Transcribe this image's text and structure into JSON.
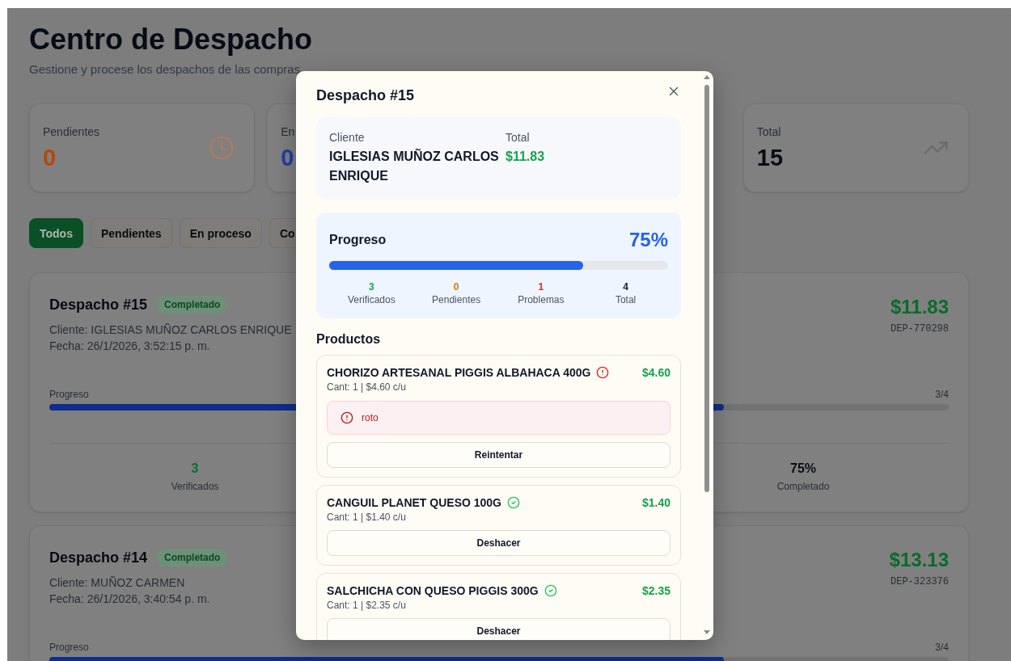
{
  "page": {
    "title": "Centro de Despacho",
    "subtitle": "Gestione y procese los despachos de las compras"
  },
  "stats": [
    {
      "label": "Pendientes",
      "value": "0",
      "color": "#b8450d",
      "kind": "clock"
    },
    {
      "label": "En",
      "value": "0",
      "color": "#1e3fa6",
      "kind": "none"
    },
    {
      "label": "Total",
      "value": "15",
      "color": "#0b0d12",
      "kind": "trend"
    }
  ],
  "filters": [
    {
      "label": "Todos",
      "selected": true
    },
    {
      "label": "Pendientes",
      "selected": false
    },
    {
      "label": "En proceso",
      "selected": false
    },
    {
      "label": "Co",
      "selected": false
    }
  ],
  "dispatches": [
    {
      "title": "Despacho #15",
      "status": "Completado",
      "client": "Cliente: IGLESIAS MUÑOZ CARLOS ENRIQUE",
      "date": "Fecha: 26/1/2026, 3:52:15 p. m.",
      "amount": "$11.83",
      "code": "DEP-770298",
      "progress_label": "Progreso",
      "progress_count": "3/4",
      "level": 0.75,
      "stats": [
        {
          "value": "3",
          "label": "Verificados",
          "color": "#0f6b30"
        },
        {
          "value": "75%",
          "label": "Completado",
          "color": "#0b0d12"
        }
      ]
    },
    {
      "title": "Despacho #14",
      "status": "Completado",
      "client": "Cliente: MUÑOZ CARMEN",
      "date": "Fecha: 26/1/2026, 3:40:54 p. m.",
      "amount": "$13.13",
      "code": "DEP-323376",
      "progress_label": "Progreso",
      "progress_count": "3/4",
      "level": 0.75
    }
  ],
  "modal": {
    "title": "Despacho #15",
    "client_label": "Cliente",
    "client_name": "IGLESIAS MUÑOZ CARLOS ENRIQUE",
    "total_label": "Total",
    "total_value": "$11.83",
    "progress": {
      "label": "Progreso",
      "percent": "75%",
      "level": 0.75,
      "stats": [
        {
          "value": "3",
          "label": "Verificados",
          "color": "#16a34a"
        },
        {
          "value": "0",
          "label": "Pendientes",
          "color": "#d97706"
        },
        {
          "value": "1",
          "label": "Problemas",
          "color": "#dc2626"
        },
        {
          "value": "4",
          "label": "Total",
          "color": "#111827"
        }
      ]
    },
    "products_heading": "Productos",
    "products": [
      {
        "name": "CHORIZO ARTESANAL PIGGIS ALBAHACA 400G",
        "kind": "problem",
        "detail": "Cant: 1 | $4.60 c/u",
        "price": "$4.60",
        "issue": "roto",
        "action": "Reintentar"
      },
      {
        "name": "CANGUIL PLANET QUESO 100G",
        "kind": "verified",
        "detail": "Cant: 1 | $1.40 c/u",
        "price": "$1.40",
        "action": "Deshacer"
      },
      {
        "name": "SALCHICHA CON QUESO PIGGIS 300G",
        "kind": "verified",
        "detail": "Cant: 1 | $2.35 c/u",
        "price": "$2.35",
        "action": "Deshacer"
      }
    ]
  }
}
